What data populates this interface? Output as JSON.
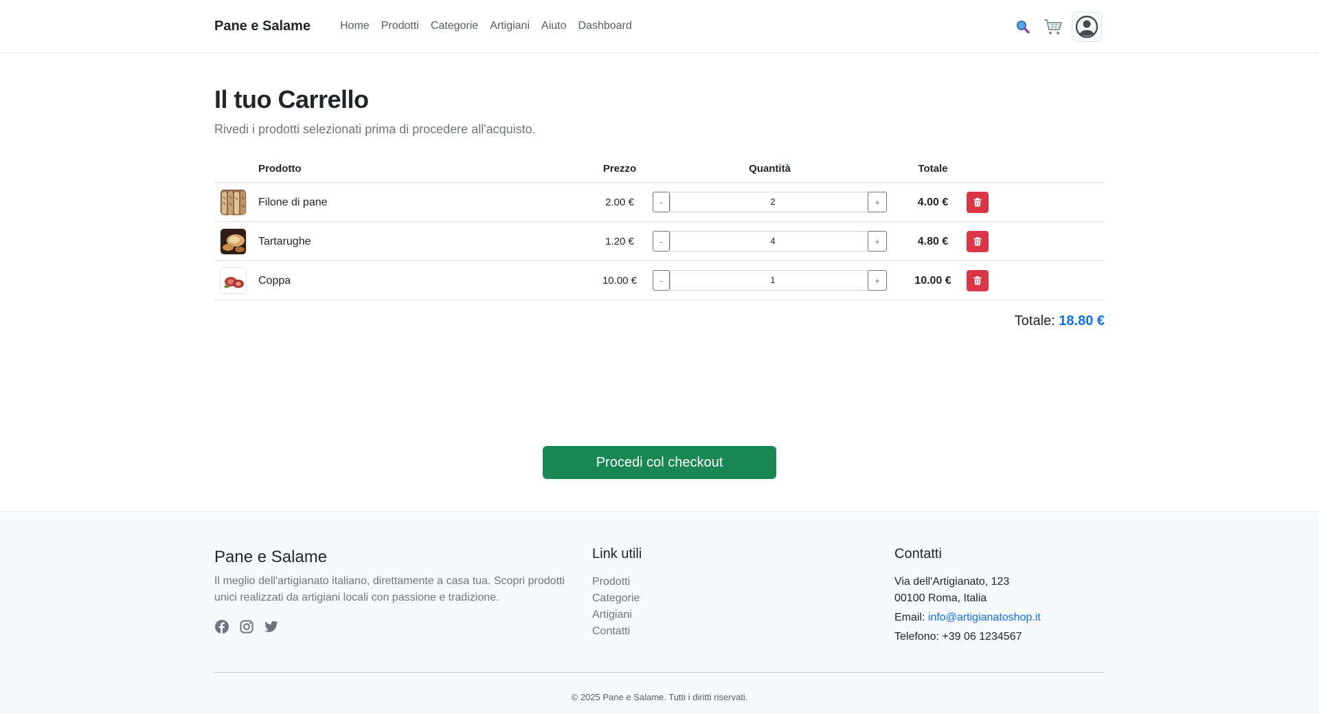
{
  "header": {
    "brand": "Pane e Salame",
    "nav": [
      "Home",
      "Prodotti",
      "Categorie",
      "Artigiani",
      "Aiuto",
      "Dashboard"
    ],
    "icons": [
      "search-icon",
      "cart-icon",
      "user-icon"
    ]
  },
  "main": {
    "title": "Il tuo Carrello",
    "subtitle": "Rivedi i prodotti selezionati prima di procedere all'acquisto.",
    "columns": {
      "product": "Prodotto",
      "price": "Prezzo",
      "quantity": "Quantità",
      "total": "Totale"
    },
    "items": [
      {
        "name": "Filone di pane",
        "price": "2.00 €",
        "quantity": "2",
        "total": "4.00 €",
        "thumbnail": "bread-image"
      },
      {
        "name": "Tartarughe",
        "price": "1.20 €",
        "quantity": "4",
        "total": "4.80 €",
        "thumbnail": "tartarughe-image"
      },
      {
        "name": "Coppa",
        "price": "10.00 €",
        "quantity": "1",
        "total": "10.00 €",
        "thumbnail": "coppa-image"
      }
    ],
    "qty_minus": "-",
    "qty_plus": "+",
    "grand_total_label": "Totale:",
    "grand_total_value": "18.80 €",
    "checkout_label": "Procedi col checkout"
  },
  "footer": {
    "brand": "Pane e Salame",
    "description": "Il meglio dell'artigianato italiano, direttamente a casa tua. Scopri prodotti unici realizzati da artigiani locali con passione e tradizione.",
    "social_icons": [
      "facebook-icon",
      "instagram-icon",
      "twitter-icon"
    ],
    "links_title": "Link utili",
    "links": [
      "Prodotti",
      "Categorie",
      "Artigiani",
      "Contatti"
    ],
    "contact_title": "Contatti",
    "address_line1": "Via dell'Artigianato, 123",
    "address_line2": "00100 Roma, Italia",
    "email_label": "Email:",
    "email": "info@artigianatoshop.it",
    "phone": "Telefono: +39 06 1234567",
    "copyright": "© 2025 Pane e Salame. Tutti i diritti riservati."
  },
  "colors": {
    "primary": "#0d6efd",
    "success": "#198754",
    "danger": "#dc3545",
    "footer_bg": "#f8f9fa"
  }
}
